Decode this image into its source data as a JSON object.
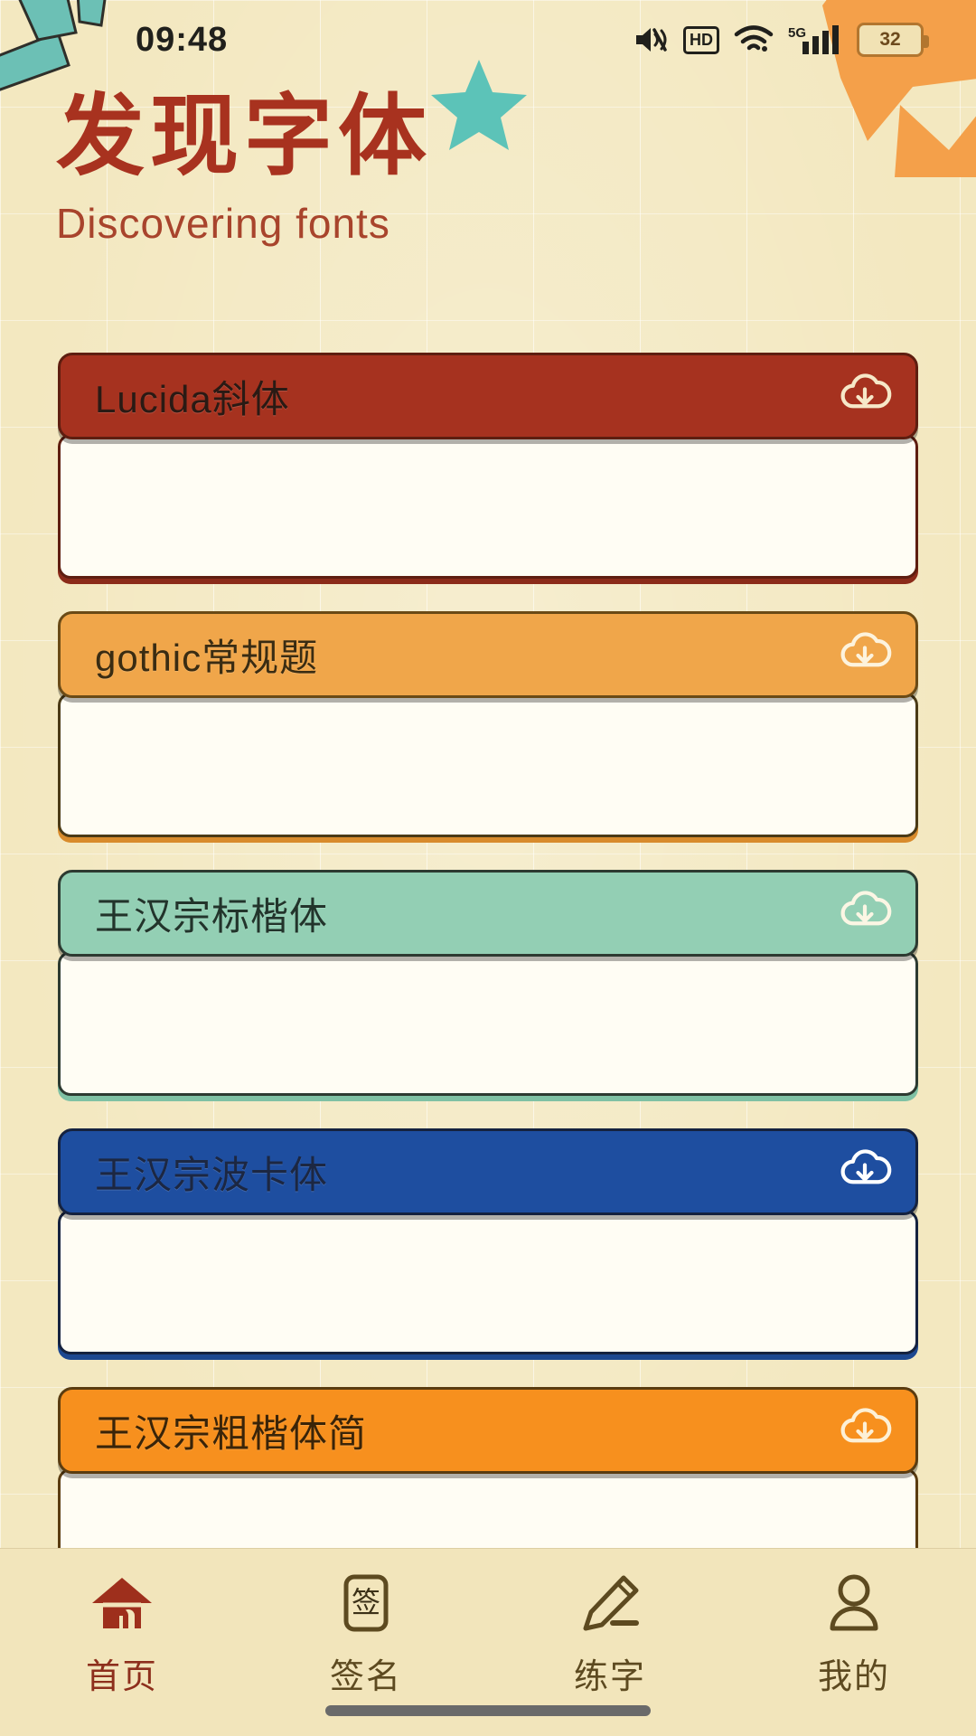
{
  "status_bar": {
    "time": "09:48",
    "icons": [
      "mute-icon",
      "hd-icon",
      "wifi-icon",
      "5g-signal-icon",
      "battery-icon"
    ],
    "hd_label": "HD",
    "network_label": "5G",
    "battery_level": "32"
  },
  "header": {
    "title": "发现字体",
    "subtitle": "Discovering fonts",
    "title_color": "#a8321f",
    "subtitle_color": "#a8442c"
  },
  "font_list": [
    {
      "name": "Lucida斜体",
      "header_color": "#a6321f",
      "border_color": "#7e2817",
      "title_color": "#2a1a14",
      "download_icon": "cloud-download-icon"
    },
    {
      "name": "gothic常规题",
      "header_color": "#f1a košt",
      "header_color_hex": "#f0a košt",
      "border_color": "#c98228",
      "title_color": "#3a2c12",
      "download_icon": "cloud-download-icon"
    },
    {
      "name": "王汉宗标楷体",
      "header_color": "#93cfb4",
      "border_color": "#6aa98c",
      "title_color": "#22342b",
      "download_icon": "cloud-download-icon"
    },
    {
      "name": "王汉宗波卡体",
      "header_color": "#1e4ea0",
      "border_color": "#143a7c",
      "title_color": "#12213f",
      "download_icon": "cloud-download-icon"
    },
    {
      "name": "王汉宗粗楷体简",
      "header_color": "#f7901e",
      "border_color": "#d2760f",
      "title_color": "#3a2408",
      "download_icon": "cloud-download-icon"
    }
  ],
  "bottom_nav": [
    {
      "label": "首页",
      "icon": "home-icon",
      "active": true
    },
    {
      "label": "签名",
      "icon": "signature-icon",
      "active": false
    },
    {
      "label": "练字",
      "icon": "pencil-icon",
      "active": false
    },
    {
      "label": "我的",
      "icon": "person-icon",
      "active": false
    }
  ],
  "theme": {
    "page_background": "#f3e8c0",
    "nav_background": "#f2e5bb",
    "accent_red": "#8d2f1c",
    "nav_label_color": "#5d4a20"
  }
}
